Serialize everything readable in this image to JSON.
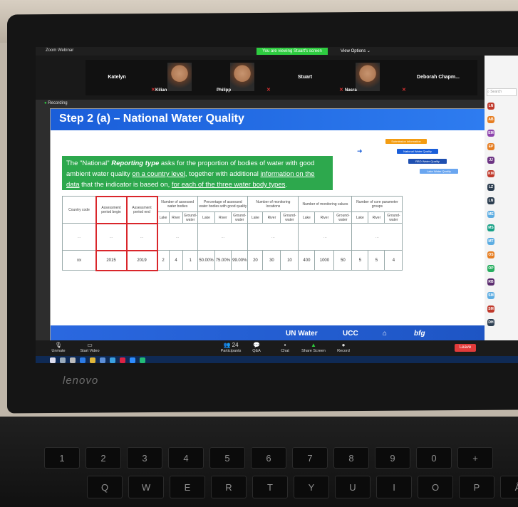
{
  "zoom": {
    "window_title": "Zoom Webinar",
    "share_banner": "You are viewing Stuart's screen",
    "view_options": "View Options ⌄",
    "participants": [
      {
        "name": "Katelyn"
      },
      {
        "name": "Kilian"
      },
      {
        "name": "Philipp"
      },
      {
        "name": "Stuart"
      },
      {
        "name": "Nasra"
      },
      {
        "name": "Deborah Chapm..."
      }
    ],
    "recording": "Recording",
    "controls": {
      "unmute": "Unmute",
      "start_video": "Start Video",
      "participants": "Participants",
      "participants_count": "24",
      "qa": "Q&A",
      "chat": "Chat",
      "share_screen": "Share Screen",
      "record": "Record",
      "leave": "Leave"
    },
    "right_panel": {
      "search_placeholder": "Search",
      "initials": [
        "LN",
        "AB",
        "EM",
        "EP",
        "JJ",
        "KM",
        "LZ",
        "LN",
        "ME",
        "MS",
        "MT",
        "OS",
        "OP",
        "RB",
        "SM",
        "SM",
        "DH"
      ]
    }
  },
  "slide": {
    "title": "Step 2 (a) – National Water Quality",
    "intro": {
      "p1": "The \"National\" ",
      "reporting_type": "Reporting type",
      "p2": " asks for the proportion of bodies of water with good ambient water quality ",
      "link1": "on a country level",
      "p3": ", together with additional ",
      "link2": "information on the data",
      "p4": " that the indicator is based on, ",
      "link3": "for each of the three water body types",
      "p5": "."
    },
    "flow": {
      "b1": "Submission information",
      "b2": "National Water Quality",
      "b3": "RBD Water Quality",
      "b4": "Lake Water Quality"
    },
    "table": {
      "headers": {
        "country_code": "Country code",
        "period_begin": "Assessment period begin",
        "period_end": "Assessment period end",
        "assessed": "Number of assessed water bodies",
        "percentage": "Percentage of assessed water bodies with good quality",
        "locations": "Number of monitoring locations",
        "values": "Number of monitoring values",
        "core": "Number of core parameter groups"
      },
      "sub": [
        "Lake",
        "River",
        "Ground-water"
      ],
      "row": {
        "country": "xx",
        "begin": "2015",
        "end": "2019",
        "assessed": [
          "2",
          "4",
          "1"
        ],
        "percentage": [
          "50.00%",
          "75.00%",
          "99.00%"
        ],
        "locations": [
          "20",
          "30",
          "10"
        ],
        "values": [
          "400",
          "1000",
          "50"
        ],
        "core": [
          "5",
          "5",
          "4"
        ]
      }
    },
    "footer": {
      "un_water": "UN Water",
      "ucc": "UCC",
      "bfg": "bfg"
    }
  },
  "laptop": {
    "brand": "lenovo"
  },
  "keyboard": {
    "row1": [
      "Q",
      "W",
      "E",
      "R",
      "T",
      "Y",
      "U",
      "I",
      "O",
      "P",
      "Å"
    ],
    "row0": [
      "1",
      "2",
      "3",
      "4",
      "5",
      "6",
      "7",
      "8",
      "9",
      "0",
      "+"
    ]
  }
}
